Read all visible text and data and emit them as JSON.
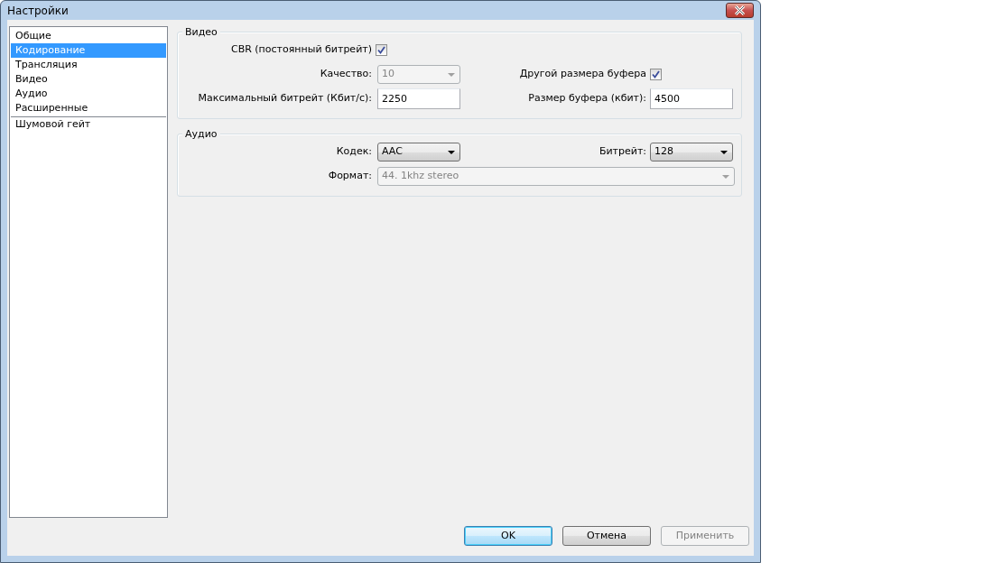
{
  "window": {
    "title": "Настройки"
  },
  "sidebar": {
    "groups": [
      {
        "items": [
          {
            "label": "Общие",
            "selected": false
          },
          {
            "label": "Кодирование",
            "selected": true
          },
          {
            "label": "Трансляция",
            "selected": false
          },
          {
            "label": "Видео",
            "selected": false
          },
          {
            "label": "Аудио",
            "selected": false
          },
          {
            "label": "Расширенные",
            "selected": false
          }
        ]
      },
      {
        "items": [
          {
            "label": "Шумовой гейт",
            "selected": false
          }
        ]
      }
    ]
  },
  "groups": [
    {
      "title": "Видео",
      "rows": [
        [
          {
            "kind": "checkbox",
            "label": "CBR (постоянный битрейт)",
            "checked": true
          }
        ],
        [
          {
            "kind": "combo",
            "label": "Качество:",
            "value": "10",
            "disabled": true
          },
          {
            "kind": "checkbox",
            "label": "Другой размера буфера",
            "checked": true
          }
        ],
        [
          {
            "kind": "text",
            "label": "Максимальный битрейт (Кбит/с):",
            "value": "2250"
          },
          {
            "kind": "text",
            "label": "Размер буфера (кбит):",
            "value": "4500"
          }
        ]
      ]
    },
    {
      "title": "Аудио",
      "rows": [
        [
          {
            "kind": "combo",
            "label": "Кодек:",
            "value": "AAC",
            "disabled": false
          },
          {
            "kind": "combo",
            "label": "Битрейт:",
            "value": "128",
            "disabled": false
          }
        ],
        [
          {
            "kind": "combo",
            "label": "Формат:",
            "value": "44. 1khz stereo",
            "disabled": true,
            "wide": true
          }
        ]
      ]
    }
  ],
  "buttons": [
    {
      "label": "OK",
      "default": true,
      "disabled": false
    },
    {
      "label": "Отмена",
      "default": false,
      "disabled": false
    },
    {
      "label": "Применить",
      "default": false,
      "disabled": true
    }
  ]
}
